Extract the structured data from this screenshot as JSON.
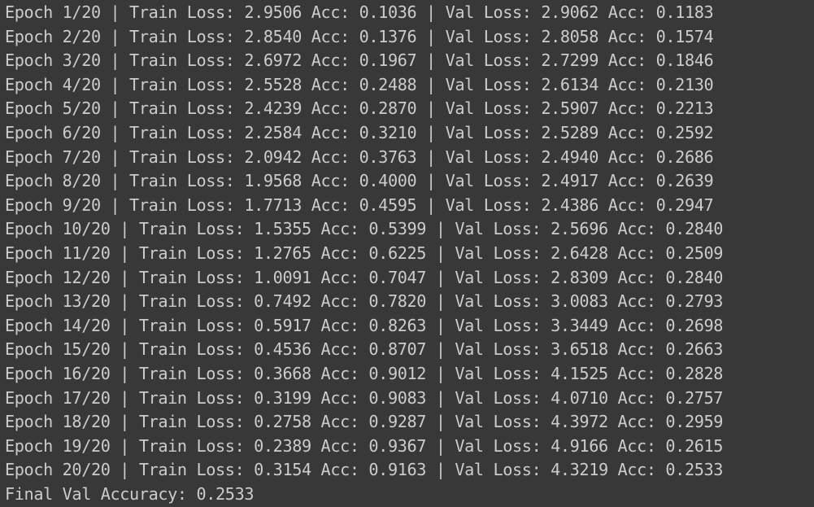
{
  "output": {
    "lines": [
      "Epoch 1/20 | Train Loss: 2.9506 Acc: 0.1036 | Val Loss: 2.9062 Acc: 0.1183",
      "Epoch 2/20 | Train Loss: 2.8540 Acc: 0.1376 | Val Loss: 2.8058 Acc: 0.1574",
      "Epoch 3/20 | Train Loss: 2.6972 Acc: 0.1967 | Val Loss: 2.7299 Acc: 0.1846",
      "Epoch 4/20 | Train Loss: 2.5528 Acc: 0.2488 | Val Loss: 2.6134 Acc: 0.2130",
      "Epoch 5/20 | Train Loss: 2.4239 Acc: 0.2870 | Val Loss: 2.5907 Acc: 0.2213",
      "Epoch 6/20 | Train Loss: 2.2584 Acc: 0.3210 | Val Loss: 2.5289 Acc: 0.2592",
      "Epoch 7/20 | Train Loss: 2.0942 Acc: 0.3763 | Val Loss: 2.4940 Acc: 0.2686",
      "Epoch 8/20 | Train Loss: 1.9568 Acc: 0.4000 | Val Loss: 2.4917 Acc: 0.2639",
      "Epoch 9/20 | Train Loss: 1.7713 Acc: 0.4595 | Val Loss: 2.4386 Acc: 0.2947",
      "Epoch 10/20 | Train Loss: 1.5355 Acc: 0.5399 | Val Loss: 2.5696 Acc: 0.2840",
      "Epoch 11/20 | Train Loss: 1.2765 Acc: 0.6225 | Val Loss: 2.6428 Acc: 0.2509",
      "Epoch 12/20 | Train Loss: 1.0091 Acc: 0.7047 | Val Loss: 2.8309 Acc: 0.2840",
      "Epoch 13/20 | Train Loss: 0.7492 Acc: 0.7820 | Val Loss: 3.0083 Acc: 0.2793",
      "Epoch 14/20 | Train Loss: 0.5917 Acc: 0.8263 | Val Loss: 3.3449 Acc: 0.2698",
      "Epoch 15/20 | Train Loss: 0.4536 Acc: 0.8707 | Val Loss: 3.6518 Acc: 0.2663",
      "Epoch 16/20 | Train Loss: 0.3668 Acc: 0.9012 | Val Loss: 4.1525 Acc: 0.2828",
      "Epoch 17/20 | Train Loss: 0.3199 Acc: 0.9083 | Val Loss: 4.0710 Acc: 0.2757",
      "Epoch 18/20 | Train Loss: 0.2758 Acc: 0.9287 | Val Loss: 4.3972 Acc: 0.2959",
      "Epoch 19/20 | Train Loss: 0.2389 Acc: 0.9367 | Val Loss: 4.9166 Acc: 0.2615",
      "Epoch 20/20 | Train Loss: 0.3154 Acc: 0.9163 | Val Loss: 4.3219 Acc: 0.2533",
      "Final Val Accuracy: 0.2533"
    ]
  },
  "colors": {
    "background": "#383838",
    "text": "#cccccc"
  }
}
